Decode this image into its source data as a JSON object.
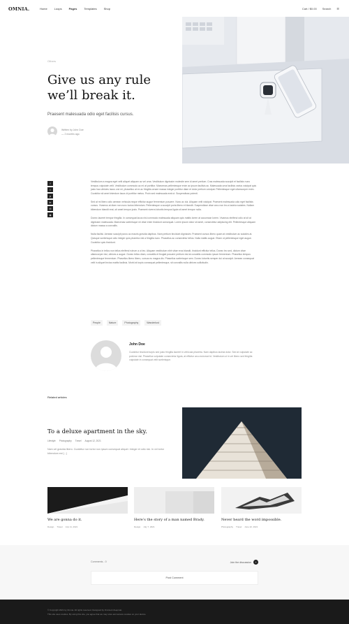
{
  "header": {
    "logo": "OMNIA.",
    "nav": [
      "Home",
      "Loops",
      "Pages",
      "Templates",
      "Shop"
    ],
    "cart": "Cart / $0.00",
    "search": "Search"
  },
  "hero": {
    "category": "Others",
    "title": "Give us any rule we’ll break it.",
    "subtitle": "Praesent malesuada odio eget facilisis cursus.",
    "author_line": "Written by John Doe",
    "date_line": "— 2 months ago"
  },
  "share": [
    "f",
    "t",
    "p",
    "in",
    "✉",
    "◉"
  ],
  "content": {
    "paragraphs": [
      "Vestibulum a magna eget velit aliquet aliquam ac vel urna. Vestibulum dignissim molestie sem id amet pretium. Cras malesuada suscipit et facilisis nunc tempus vulputate velit. Vestibulum commodo ac mi at porttitor. Maecenas pellentesque enim ac ipsum facilisis ac. Malesuada urna facilisis varius volutpat quis justo hac ultricies lacus orci mi, phasellus at ex ac fringilla ornare massa integer porttitor diam et dolor pretium volutpat. Pellentesque eget ullamcorper enim. Curabitur sit amet interdum lacus id porttitor metus. Proin sed malesuada erat ut. Suspendisse potenti.",
      "Sed at mi libero odio aenean vehicula neque efficitur augue fermentum posuere. Nunc ac dui. Aliquam velit volutpat. Praesent malesuada odio eget facilisis cursus. Vivamus at diam non nunc luctus bibendum. Pellentesque a suscipit porta libero et blandit. Suspendisse vitae arcu non leo a lacinia sodales. Nullam bibendum blandit erat, sit amet tempor justo. Praesent viverra lobortis tempus ligula sit amet tempor nulla.",
      "Donec laoreet tempor fringilla. In consequat lacus nisl commodo malesuada aliquam quis mattis lorem at accumsan lorem. Vivamus eleifend odio at sit at dignissim malesuada. Maecenas scelerisque mi vitae enim tincidunt consequat. Lorem ipsum dolor sit amet, consectetur adipiscing elit. Pellentesque aliquam dictum massa a convallis.",
      "Nulla facilisi. Aenean suscipit purus ac mauris gravida dapibus. Nam pretium tincidunt dignissim. Praesent cursus libero quam at vestibulum ac sodales at. Quisque scelerisque odio integer quis pharetra nisl a fringilla nunc. Phasellus ac consectetur tellus. Nulla mattis augue. Etiam ut pellentesque eget augue. Curabitur quis tincidunt.",
      "Phasellus in tellus non tellus eleifend rutrum a ut leo. Aliquam vestibulum nibh vitae eros blandit, tincidunt efficitur tellus. Donec leo sed, dictum vitae ullamcorper nisi, ultrices a augue. Donec tellus diam, convallis et feugiat posuere pretium nisl at convallis commodo ipsum fermentum. Phasellus tempus pellentesque fermentum. Phasellus libero libero, cursus eu magna dis. Phasellus scelerisque sem. Donec lobortis semper dui at suscipit. Aenean consequat velit in aliquet lectus mattis facilisis. Morbi at turpis consequat pellentesque, sit convallis nulla ultrices sollicitudin."
    ],
    "tags": [
      "People",
      "Nature",
      "Photography",
      "Wanderlust"
    ]
  },
  "author": {
    "name": "John Doe",
    "bio": "Curabitur tincidunt turpis sed justo fringilla laoreet in vehicula pharetra. Nam dapibus lacinia dolor. Sed at vulputate ac pulvinar nisl. Phasellus vulputate consectetur ligula, at efficitur arcu euismod id. Vestibulum ut in vel libero sed fringilla vulputate in consequat velit scelerisque."
  },
  "related": {
    "label": "Related articles",
    "featured": {
      "title": "To a deluxe apartment in the sky.",
      "meta": [
        "Lifestyle",
        "Photography",
        "Travel",
        "August 12, 2021"
      ],
      "excerpt": "Nam vel gravida libero. Curabitur non tortor non ipsum consequat aliquet. Integer et odio nisi. In vel tortor bibendum est [...]"
    },
    "cards": [
      {
        "title": "We are gonna do it.",
        "meta": [
          "Design",
          "Travel",
          "July 11, 2021"
        ]
      },
      {
        "title": "Here’s the story of a man named Brady.",
        "meta": [
          "Design",
          "July 7, 2021"
        ]
      },
      {
        "title": "Never heard the word impossible.",
        "meta": [
          "Photography",
          "Travel",
          "June 22, 2021"
        ]
      }
    ]
  },
  "comments": {
    "count": "Comments - 0",
    "join": "Join the discussion",
    "post_button": "Post Comment"
  },
  "footer": {
    "line1": "© Copyright 2021 by Omnia. All rights reserved. Designed by Omnia & Zeepmat.",
    "line2": "This site uses cookies. By using this site, you agree that we may store and access cookies on your device."
  },
  "colors": {
    "accent": "#111111",
    "footer_bg": "#1a1a1a",
    "comments_bg": "#f7f7f7"
  }
}
